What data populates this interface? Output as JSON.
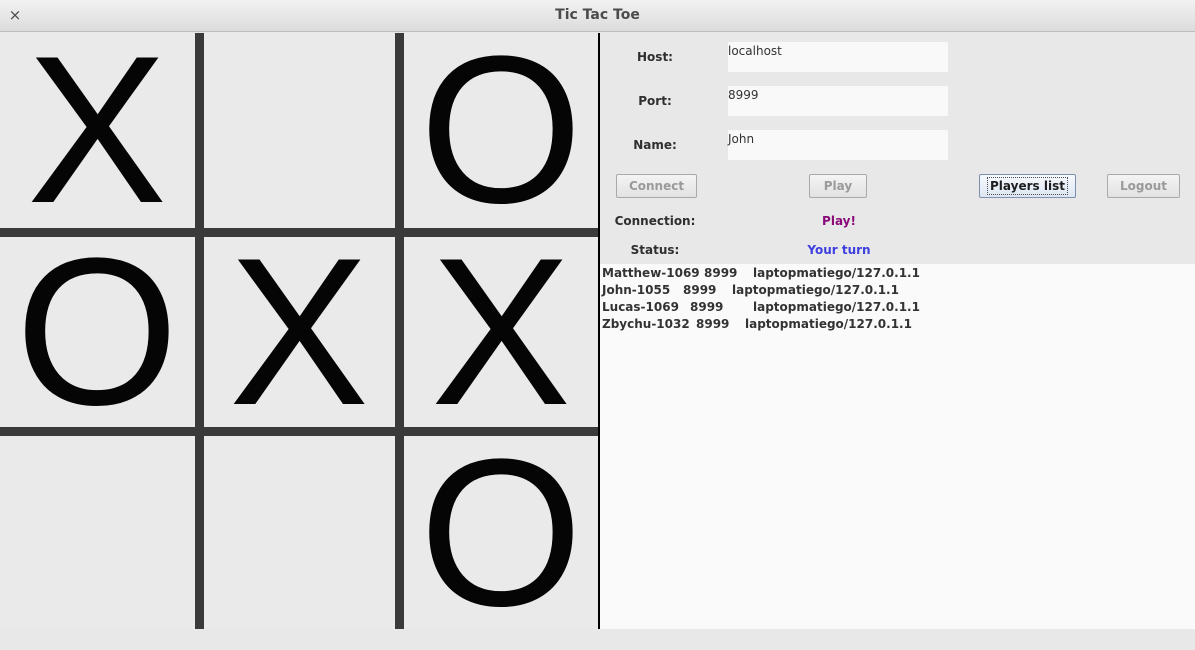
{
  "window": {
    "title": "Tic Tac Toe",
    "close_symbol": "×"
  },
  "board": {
    "cells": [
      "X",
      "",
      "O",
      "O",
      "X",
      "X",
      "",
      "",
      "O"
    ]
  },
  "form": {
    "host_label": "Host:",
    "host_value": "localhost",
    "port_label": "Port:",
    "port_value": "8999",
    "name_label": "Name:",
    "name_value": "John"
  },
  "buttons": {
    "connect": "Connect",
    "play": "Play",
    "players_list": "Players list",
    "logout": "Logout"
  },
  "status": {
    "connection_label": "Connection:",
    "connection_value": "Play!",
    "status_label": "Status:",
    "status_value": "Your turn",
    "connection_color": "#8a0b7a",
    "status_color": "#3d3fe0"
  },
  "players": [
    {
      "name": "Matthew-1069",
      "port": "8999",
      "host": "laptopmatiego/127.0.1.1"
    },
    {
      "name": "John-1055",
      "port": "8999",
      "host": "laptopmatiego/127.0.1.1"
    },
    {
      "name": "Lucas-1069",
      "port": "8999",
      "host": "laptopmatiego/127.0.1.1"
    },
    {
      "name": "Zbychu-1032",
      "port": "8999",
      "host": "laptopmatiego/127.0.1.1"
    }
  ]
}
